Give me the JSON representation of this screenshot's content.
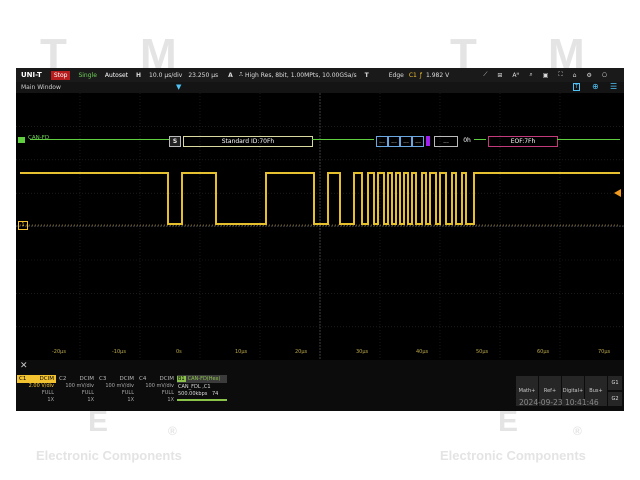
{
  "watermark": {
    "brand_top": "T",
    "brand_m": "M",
    "brand_e": "E",
    "reg": "®",
    "caption": "Electronic Components"
  },
  "toolbar": {
    "logo": "UNI-T",
    "run_stop": "Stop",
    "single": "Single",
    "autoset": "Autoset",
    "h_label": "H",
    "timebase": "10.0 µs/div",
    "h_pos": "23.250 µs",
    "acq_label": "A",
    "acq_info": "High Res, 8bit, 1.00MPts, 10.00GSa/s",
    "trig_label": "T",
    "trig_type": "Edge",
    "trig_ch": "C1",
    "trig_level": "1.982 V"
  },
  "window": {
    "title": "Main Window"
  },
  "bus": {
    "label": "CAN-FD",
    "start": "S",
    "id_frame": "Standard ID:70Fh",
    "data_cells": [
      "...",
      "...",
      "...",
      "..."
    ],
    "ellipsis": "...",
    "crc": "0h",
    "eof": "EOF:7Fh"
  },
  "time_ticks": [
    "-20µs",
    "-10µs",
    "0s",
    "10µs",
    "20µs",
    "30µs",
    "40µs",
    "50µs",
    "60µs",
    "70µs"
  ],
  "channels": [
    {
      "name": "C1",
      "mode": "DCIM",
      "scale": "2.00 V/div",
      "bw": "FULL",
      "probe": "1X",
      "color": "#f2c230"
    },
    {
      "name": "C2",
      "mode": "DCIM",
      "scale": "100 mV/div",
      "bw": "FULL",
      "probe": "1X",
      "color": "#4fc3f7"
    },
    {
      "name": "C3",
      "mode": "DCIM",
      "scale": "100 mV/div",
      "bw": "FULL",
      "probe": "1X",
      "color": "#e040fb"
    },
    {
      "name": "C4",
      "mode": "DCIM",
      "scale": "100 mV/div",
      "bw": "FULL",
      "probe": "1X",
      "color": "#66bb6a"
    }
  ],
  "decoder": {
    "tag": "B1",
    "title": "CAN-FD(Hex)",
    "line1": "CAN_FDL ,C1",
    "line2": "500.00kbps",
    "count": "74"
  },
  "right_buttons": [
    "Math+",
    "Ref+",
    "Digital+",
    "Bus+"
  ],
  "g_buttons": [
    "G1",
    "G2"
  ],
  "datetime": "2024-09-23 10:41:46",
  "colors": {
    "c1": "#f2c230",
    "decode": "#8bc34a",
    "bus_green": "#5fcf3f"
  }
}
